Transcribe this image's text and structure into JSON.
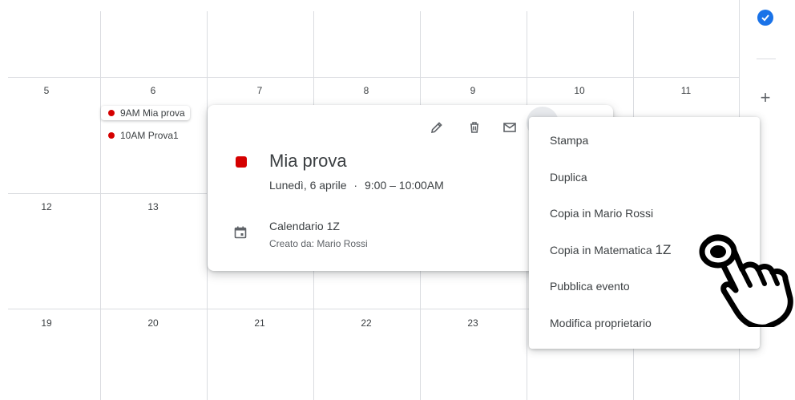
{
  "calendar": {
    "rows": [
      {
        "days": [
          "",
          "",
          "",
          "",
          "",
          "",
          ""
        ]
      },
      {
        "days": [
          "5",
          "6",
          "7",
          "8",
          "9",
          "10",
          "11"
        ]
      },
      {
        "days": [
          "12",
          "13",
          "",
          "",
          "",
          "",
          ""
        ]
      },
      {
        "days": [
          "19",
          "20",
          "21",
          "22",
          "23",
          "",
          ""
        ]
      }
    ],
    "events": [
      {
        "time": "9AM",
        "title": "Mia prova"
      },
      {
        "time": "10AM",
        "title": "Prova1"
      }
    ],
    "event_color": "#d50000"
  },
  "sidebar": {
    "tasks_icon": "check-circle-icon",
    "add_icon": "plus-icon",
    "add_label": "+"
  },
  "popup": {
    "tools": [
      "edit-icon",
      "delete-icon",
      "email-icon",
      "more-options-icon"
    ],
    "title": "Mia prova",
    "date": "Lunedì, 6 aprile",
    "separator": "·",
    "time_range": "9:00 – 10:00AM",
    "calendar_name": "Calendario 1Z",
    "created_by": "Creato da: Mario Rossi"
  },
  "menu": {
    "items": [
      {
        "label": "Stampa"
      },
      {
        "label": "Duplica"
      },
      {
        "label": "Copia in Mario Rossi"
      },
      {
        "label": "Copia in Matematica",
        "suffix": "1Z"
      },
      {
        "label": "Pubblica evento"
      },
      {
        "label": "Modifica proprietario"
      }
    ]
  },
  "cursor": {
    "icon": "pointing-hand-cursor-icon"
  }
}
